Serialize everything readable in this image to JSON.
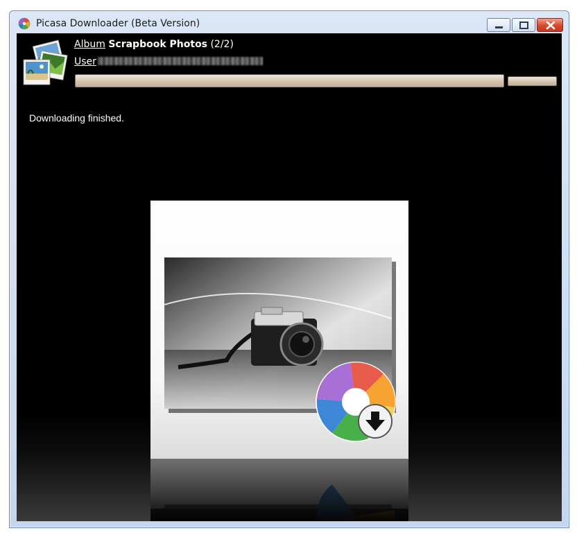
{
  "window": {
    "title": "Picasa Downloader (Beta Version)"
  },
  "header": {
    "album_label": "Album",
    "album_name": "Scrapbook Photos",
    "album_count": "(2/2)",
    "user_label": "User"
  },
  "status": {
    "message": "Downloading finished."
  },
  "progress": {
    "main_fraction": 1.0,
    "secondary_fraction": 1.0
  },
  "icons": {
    "app": "picasa-pinwheel-icon",
    "album": "photo-stack-icon",
    "logo": "camera-photo-download-logo"
  }
}
